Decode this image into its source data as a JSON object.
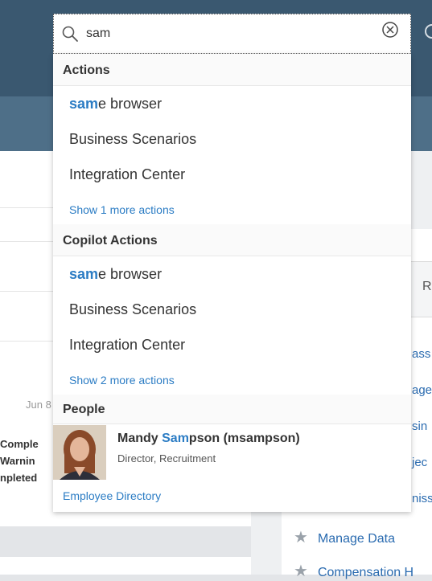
{
  "search": {
    "query": "sam"
  },
  "sections": {
    "actions": {
      "header": "Actions",
      "items": [
        {
          "hl": "sam",
          "rest": "e browser"
        },
        {
          "hl": "",
          "rest": "Business Scenarios"
        },
        {
          "hl": "",
          "rest": "Integration Center"
        }
      ],
      "more": "Show 1 more actions"
    },
    "copilot": {
      "header": "Copilot Actions",
      "items": [
        {
          "hl": "sam",
          "rest": "e browser"
        },
        {
          "hl": "",
          "rest": "Business Scenarios"
        },
        {
          "hl": "",
          "rest": "Integration Center"
        }
      ],
      "more": "Show 2 more actions"
    },
    "people": {
      "header": "People",
      "person": {
        "name_prefix": "Mandy ",
        "name_hl": "Sam",
        "name_suffix": "pson (msampson)",
        "title": "Director, Recruitment"
      },
      "directory_link": "Employee Directory"
    }
  },
  "background": {
    "date": "Jun 8",
    "status_lines": [
      "Comple",
      "Warnin",
      "npleted"
    ],
    "right_tab": "R",
    "right_links": [
      "ass",
      "age",
      "sin",
      "jec",
      "niss"
    ],
    "tiles": [
      "Manage Data",
      "Compensation H"
    ]
  },
  "colors": {
    "accent": "#2b7cc4",
    "header": "#3a5870"
  },
  "icons": {
    "search": "magnifier",
    "clear": "circle-x",
    "tile": "star"
  }
}
